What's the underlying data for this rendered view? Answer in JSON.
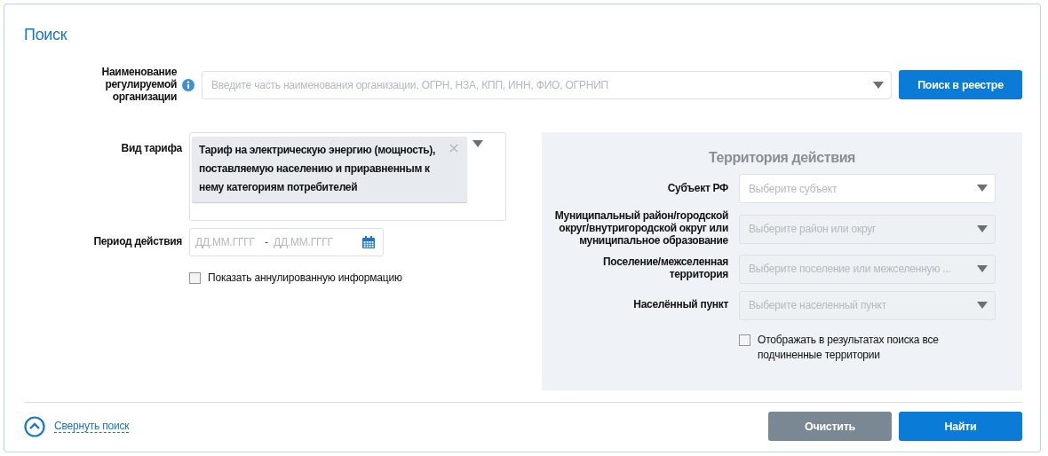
{
  "title": "Поиск",
  "organization": {
    "label": "Наименование регулируемой организации",
    "placeholder": "Введите часть наименования организации, ОГРН, НЗА, КПП, ИНН, ФИО, ОГРНИП",
    "button": "Поиск в реестре"
  },
  "tariff": {
    "label": "Вид тарифа",
    "tags": [
      "Тариф на электрическую энергию (мощность), поставляемую населению и приравненным к нему категориям потребителей"
    ]
  },
  "period": {
    "label": "Период действия",
    "from_placeholder": "ДД.ММ.ГГГГ",
    "separator": "-",
    "to_placeholder": "ДД.ММ.ГГГГ"
  },
  "show_annulled": {
    "label": "Показать аннулированную информацию",
    "checked": false
  },
  "territory": {
    "title": "Территория действия",
    "fields": [
      {
        "label": "Субъект РФ",
        "placeholder": "Выберите субъект",
        "disabled": false
      },
      {
        "label": "Муниципальный район/городской округ/внутригородской округ или муниципальное образование",
        "placeholder": "Выберите район или округ",
        "disabled": true
      },
      {
        "label": "Поселение/межселенная территория",
        "placeholder": "Выберите поселение или межселенную ...",
        "disabled": true
      },
      {
        "label": "Населённый пункт",
        "placeholder": "Выберите населенный пункт",
        "disabled": true
      }
    ],
    "include_subordinate": {
      "label": "Отображать в результатах поиска все подчиненные территории",
      "checked": false
    }
  },
  "collapse_link": "Свернуть поиск",
  "buttons": [
    {
      "label": "Очистить",
      "kind": "secondary"
    },
    {
      "label": "Найти",
      "kind": "primary"
    }
  ]
}
